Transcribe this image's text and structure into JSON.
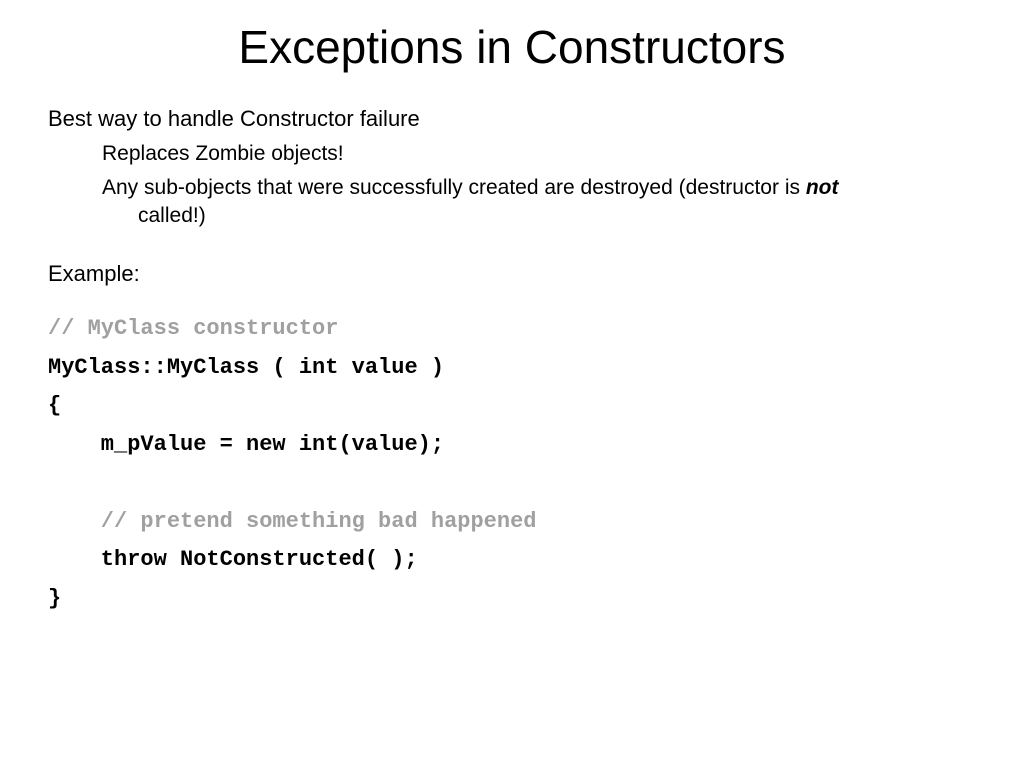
{
  "title": "Exceptions in Constructors",
  "points": {
    "p1": "Best way to handle Constructor failure",
    "p1a": "Replaces Zombie objects!",
    "p1b_prefix": "Any sub-objects that were successfully created are destroyed (destructor is ",
    "p1b_em": "not",
    "p1b_suffix": " called!)"
  },
  "example_label": "Example:",
  "code": {
    "c1": "// MyClass constructor",
    "c2": "MyClass::MyClass ( int value )",
    "c3": "{",
    "c4": "    m_pValue = new int(value);",
    "c5": " ",
    "c6": "    // pretend something bad happened",
    "c7": "    throw NotConstructed( );",
    "c8": "}"
  }
}
